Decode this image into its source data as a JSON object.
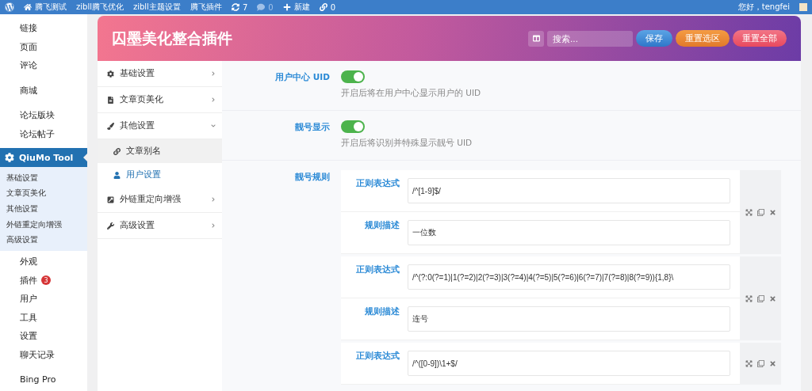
{
  "admin_bar": {
    "items": [
      {
        "kind": "home",
        "label": "腾飞测试"
      },
      {
        "kind": "text",
        "label": "zibll腾飞优化"
      },
      {
        "kind": "text",
        "label": "zibll主题设置"
      },
      {
        "kind": "text",
        "label": "腾飞插件"
      },
      {
        "kind": "updates",
        "label": "7"
      },
      {
        "kind": "comments",
        "label": "0"
      },
      {
        "kind": "new",
        "label": "新建"
      },
      {
        "kind": "links",
        "label": "0"
      }
    ],
    "greeting": "您好，tengfei"
  },
  "sidebar": {
    "groups": [
      [
        {
          "label": "链接"
        },
        {
          "label": "页面"
        },
        {
          "label": "评论"
        }
      ],
      [
        {
          "label": "商城"
        }
      ],
      [
        {
          "label": "论坛版块"
        },
        {
          "label": "论坛帖子"
        }
      ]
    ],
    "current": {
      "label": "QiuMo Tool",
      "submenu": [
        "基础设置",
        "文章页美化",
        "其他设置",
        "外链重定向增强",
        "高级设置"
      ]
    },
    "groups_after": [
      [
        {
          "label": "外观"
        },
        {
          "label": "插件",
          "badge": "3"
        },
        {
          "label": "用户"
        },
        {
          "label": "工具"
        },
        {
          "label": "设置"
        },
        {
          "label": "聊天记录"
        }
      ],
      [
        {
          "label": "Bing Pro"
        }
      ]
    ]
  },
  "panel": {
    "title": "囚墨美化整合插件",
    "search": {
      "placeholder": "搜索..."
    },
    "buttons": [
      {
        "kind": "save",
        "label": "保存"
      },
      {
        "kind": "reset-section",
        "label": "重置选区"
      },
      {
        "kind": "reset-all",
        "label": "重置全部"
      }
    ]
  },
  "nav": [
    {
      "kind": "gear",
      "label": "基础设置",
      "expanded": false
    },
    {
      "kind": "doc",
      "label": "文章页美化",
      "expanded": false
    },
    {
      "kind": "brush",
      "label": "其他设置",
      "expanded": true,
      "children": [
        {
          "kind": "link",
          "label": "文章别名",
          "selected": false
        },
        {
          "kind": "user",
          "label": "用户设置",
          "selected": true
        }
      ]
    },
    {
      "kind": "external",
      "label": "外链重定向增强",
      "expanded": false
    },
    {
      "kind": "wrench",
      "label": "高级设置",
      "expanded": false
    }
  ],
  "fields": [
    {
      "kind": "switch",
      "label": "用户中心 UID",
      "on": true,
      "description": "开启后将在用户中心显示用户的 UID"
    },
    {
      "kind": "switch",
      "label": "靓号显示",
      "on": true,
      "description": "开启后将识别并特殊显示靓号 UID"
    },
    {
      "kind": "repeater",
      "label": "靓号规则",
      "groups": [
        [
          {
            "label": "正则表达式",
            "value": "/^[1-9]$/"
          },
          {
            "label": "规则描述",
            "value": "一位数"
          }
        ],
        [
          {
            "label": "正则表达式",
            "value": "/^(?:0(?=1)|1(?=2)|2(?=3)|3(?=4)|4(?=5)|5(?=6)|6(?=7)|7(?=8)|8(?=9)){1,8}\\"
          },
          {
            "label": "规则描述",
            "value": "连号"
          }
        ],
        [
          {
            "label": "正则表达式",
            "value": "/^([0-9])\\1+$/"
          }
        ]
      ]
    }
  ]
}
